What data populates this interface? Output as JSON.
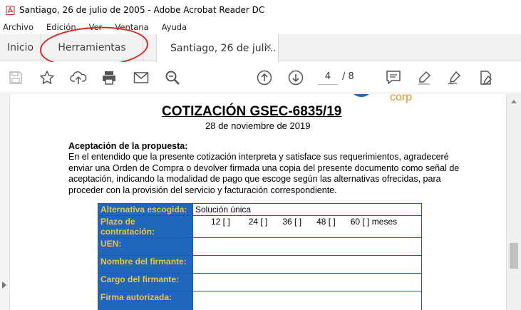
{
  "window": {
    "title": "Santiago, 26 de julio de 2005 - Adobe Acrobat Reader DC"
  },
  "menu": [
    "Archivo",
    "Edición",
    "Ver",
    "Ventana",
    "Ayuda"
  ],
  "tabs": {
    "home": "Inicio",
    "tools": "Herramientas",
    "document": "Santiago, 26 de juli...",
    "close": "×"
  },
  "toolbar": {
    "current_page": "4",
    "page_total": "/ 8"
  },
  "colors": {
    "annotation_circle": "#e0241c",
    "table_label_bg": "#1f66bd",
    "table_label_text": "#f3c23a",
    "logo_orange": "#e8902a"
  },
  "document": {
    "logo_text": "corp",
    "title": "COTIZACIÓN GSEC-6835/19",
    "date": "28 de noviembre de 2019",
    "section_heading": "Aceptación de la propuesta:",
    "paragraph": "En el entendido que la presente cotización interpreta y satisface sus requerimientos, agradeceré enviar una Orden de Compra o devolver firmada una copia del presente documento como señal de aceptación, indicando la modalidad de pago que escoge según las alternativas ofrecidas, para proceder con la provisión del servicio y facturación correspondiente.",
    "form": {
      "alternativa_label": "Alternativa escogida:",
      "alternativa_value": "Solución única",
      "plazo_label": "Plazo de contratación:",
      "plazo_options": [
        "12 [ ]",
        "24 [ ]",
        "36 [ ]",
        "48 [ ]",
        "60 [ ] meses"
      ],
      "uen_label": "UEN:",
      "nombre_label": "Nombre del firmante:",
      "cargo_label": "Cargo del firmante:",
      "firma_label": "Firma autorizada:"
    }
  }
}
